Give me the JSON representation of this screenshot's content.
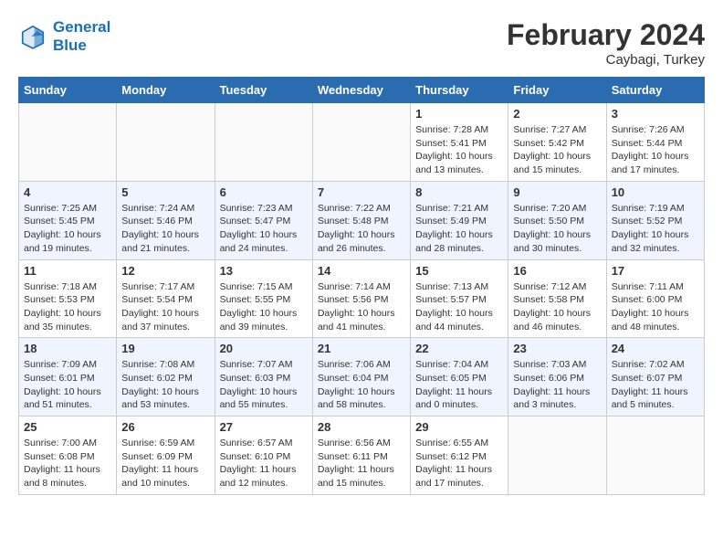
{
  "header": {
    "logo_line1": "General",
    "logo_line2": "Blue",
    "month": "February 2024",
    "location": "Caybagi, Turkey"
  },
  "weekdays": [
    "Sunday",
    "Monday",
    "Tuesday",
    "Wednesday",
    "Thursday",
    "Friday",
    "Saturday"
  ],
  "weeks": [
    [
      {
        "day": "",
        "empty": true
      },
      {
        "day": "",
        "empty": true
      },
      {
        "day": "",
        "empty": true
      },
      {
        "day": "",
        "empty": true
      },
      {
        "day": "1",
        "sunrise": "7:28 AM",
        "sunset": "5:41 PM",
        "daylight": "10 hours and 13 minutes."
      },
      {
        "day": "2",
        "sunrise": "7:27 AM",
        "sunset": "5:42 PM",
        "daylight": "10 hours and 15 minutes."
      },
      {
        "day": "3",
        "sunrise": "7:26 AM",
        "sunset": "5:44 PM",
        "daylight": "10 hours and 17 minutes."
      }
    ],
    [
      {
        "day": "4",
        "sunrise": "7:25 AM",
        "sunset": "5:45 PM",
        "daylight": "10 hours and 19 minutes."
      },
      {
        "day": "5",
        "sunrise": "7:24 AM",
        "sunset": "5:46 PM",
        "daylight": "10 hours and 21 minutes."
      },
      {
        "day": "6",
        "sunrise": "7:23 AM",
        "sunset": "5:47 PM",
        "daylight": "10 hours and 24 minutes."
      },
      {
        "day": "7",
        "sunrise": "7:22 AM",
        "sunset": "5:48 PM",
        "daylight": "10 hours and 26 minutes."
      },
      {
        "day": "8",
        "sunrise": "7:21 AM",
        "sunset": "5:49 PM",
        "daylight": "10 hours and 28 minutes."
      },
      {
        "day": "9",
        "sunrise": "7:20 AM",
        "sunset": "5:50 PM",
        "daylight": "10 hours and 30 minutes."
      },
      {
        "day": "10",
        "sunrise": "7:19 AM",
        "sunset": "5:52 PM",
        "daylight": "10 hours and 32 minutes."
      }
    ],
    [
      {
        "day": "11",
        "sunrise": "7:18 AM",
        "sunset": "5:53 PM",
        "daylight": "10 hours and 35 minutes."
      },
      {
        "day": "12",
        "sunrise": "7:17 AM",
        "sunset": "5:54 PM",
        "daylight": "10 hours and 37 minutes."
      },
      {
        "day": "13",
        "sunrise": "7:15 AM",
        "sunset": "5:55 PM",
        "daylight": "10 hours and 39 minutes."
      },
      {
        "day": "14",
        "sunrise": "7:14 AM",
        "sunset": "5:56 PM",
        "daylight": "10 hours and 41 minutes."
      },
      {
        "day": "15",
        "sunrise": "7:13 AM",
        "sunset": "5:57 PM",
        "daylight": "10 hours and 44 minutes."
      },
      {
        "day": "16",
        "sunrise": "7:12 AM",
        "sunset": "5:58 PM",
        "daylight": "10 hours and 46 minutes."
      },
      {
        "day": "17",
        "sunrise": "7:11 AM",
        "sunset": "6:00 PM",
        "daylight": "10 hours and 48 minutes."
      }
    ],
    [
      {
        "day": "18",
        "sunrise": "7:09 AM",
        "sunset": "6:01 PM",
        "daylight": "10 hours and 51 minutes."
      },
      {
        "day": "19",
        "sunrise": "7:08 AM",
        "sunset": "6:02 PM",
        "daylight": "10 hours and 53 minutes."
      },
      {
        "day": "20",
        "sunrise": "7:07 AM",
        "sunset": "6:03 PM",
        "daylight": "10 hours and 55 minutes."
      },
      {
        "day": "21",
        "sunrise": "7:06 AM",
        "sunset": "6:04 PM",
        "daylight": "10 hours and 58 minutes."
      },
      {
        "day": "22",
        "sunrise": "7:04 AM",
        "sunset": "6:05 PM",
        "daylight": "11 hours and 0 minutes."
      },
      {
        "day": "23",
        "sunrise": "7:03 AM",
        "sunset": "6:06 PM",
        "daylight": "11 hours and 3 minutes."
      },
      {
        "day": "24",
        "sunrise": "7:02 AM",
        "sunset": "6:07 PM",
        "daylight": "11 hours and 5 minutes."
      }
    ],
    [
      {
        "day": "25",
        "sunrise": "7:00 AM",
        "sunset": "6:08 PM",
        "daylight": "11 hours and 8 minutes."
      },
      {
        "day": "26",
        "sunrise": "6:59 AM",
        "sunset": "6:09 PM",
        "daylight": "11 hours and 10 minutes."
      },
      {
        "day": "27",
        "sunrise": "6:57 AM",
        "sunset": "6:10 PM",
        "daylight": "11 hours and 12 minutes."
      },
      {
        "day": "28",
        "sunrise": "6:56 AM",
        "sunset": "6:11 PM",
        "daylight": "11 hours and 15 minutes."
      },
      {
        "day": "29",
        "sunrise": "6:55 AM",
        "sunset": "6:12 PM",
        "daylight": "11 hours and 17 minutes."
      },
      {
        "day": "",
        "empty": true
      },
      {
        "day": "",
        "empty": true
      }
    ]
  ],
  "labels": {
    "sunrise": "Sunrise:",
    "sunset": "Sunset:",
    "daylight": "Daylight:"
  }
}
